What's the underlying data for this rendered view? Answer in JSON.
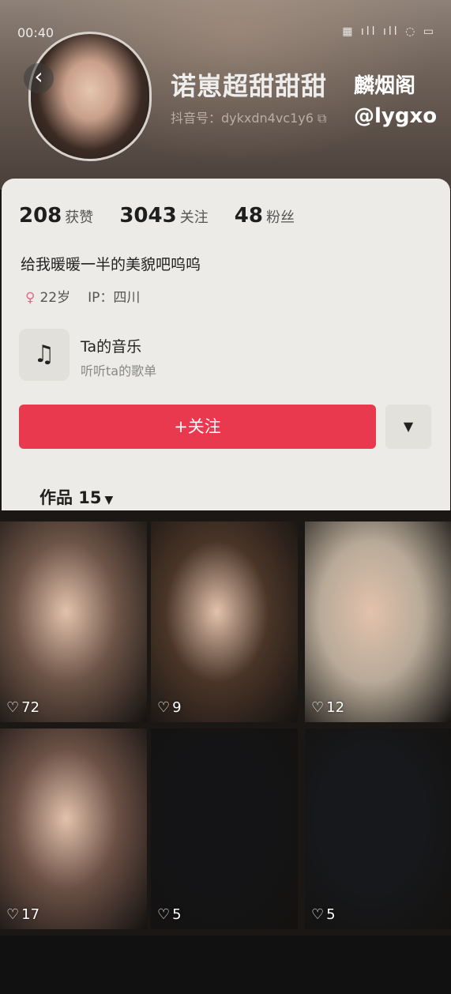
{
  "status_bar": {
    "time": "00:40",
    "icons": "▦ ıll ıll ◌ ▭"
  },
  "profile": {
    "username": "诺崽超甜甜甜",
    "douyin_id": "抖音号：dykxdn4vc1y6 ⧉",
    "back_icon": "chevron-left-icon"
  },
  "watermark": {
    "line1": "麟烟阁",
    "line2": "@lygxo"
  },
  "stats": [
    {
      "value": "208",
      "label": "获赞"
    },
    {
      "value": "3043",
      "label": "关注"
    },
    {
      "value": "48",
      "label": "粉丝"
    }
  ],
  "bio": "给我暖暖一半的美貌吧呜呜",
  "meta": {
    "gender_icon": "♀",
    "age": "22岁",
    "ip": "IP：四川"
  },
  "music": {
    "icon": "♫",
    "title": "Ta的音乐",
    "subtitle": "听听ta的歌单"
  },
  "actions": {
    "follow": "+关注",
    "more_icon": "▼"
  },
  "works_tab": {
    "label": "作品 15",
    "arrow": "▼"
  },
  "posts": [
    {
      "likes": "72",
      "tone": "#6d5447"
    },
    {
      "likes": "9",
      "tone": "#4a3528"
    },
    {
      "likes": "12",
      "tone": "#b8aa98"
    },
    {
      "likes": "17",
      "tone": "#6b5045"
    },
    {
      "likes": "5",
      "tone": "#141416"
    },
    {
      "likes": "5",
      "tone": "#17181b"
    }
  ],
  "heart_icon": "♡"
}
